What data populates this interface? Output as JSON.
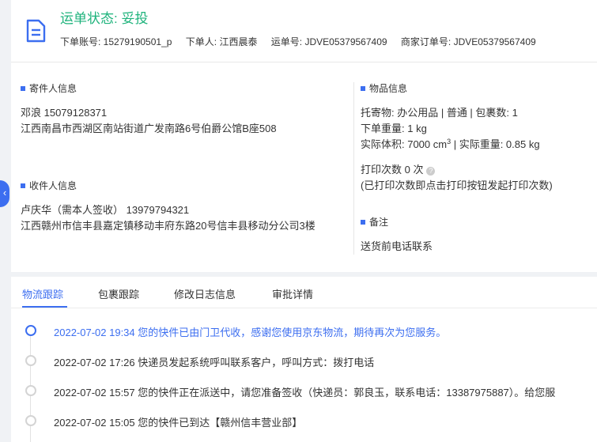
{
  "header": {
    "status": "运单状态: 妥投",
    "order_account": "下单账号: 15279190501_p",
    "orderer": "下单人: 江西晨泰",
    "waybill": "运单号: JDVE05379567409",
    "merchant_order": "商家订单号: JDVE05379567409"
  },
  "sender": {
    "title": "寄件人信息",
    "name_phone": "邓浪    15079128371",
    "address": "江西南昌市西湖区南站街道广发南路6号伯爵公馆B座508"
  },
  "receiver": {
    "title": "收件人信息",
    "name_phone": "卢庆华（需本人签收）   13979794321",
    "address": "江西赣州市信丰县嘉定镇移动丰府东路20号信丰县移动分公司3楼"
  },
  "goods": {
    "title": "物品信息",
    "line1": "托寄物:  办公用品 | 普通  |  包裹数:  1",
    "line2": "下单重量:  1 kg",
    "volume_prefix": "实际体积:   7000 cm",
    "volume_sup": "3",
    "volume_suffix": " |  实际重量:   0.85 kg",
    "print_count": "打印次数    0 次",
    "help_glyph": "?",
    "print_note": "(已打印次数即点击打印按钮发起打印次数)"
  },
  "remark": {
    "title": "备注",
    "text": "送货前电话联系"
  },
  "side_tab": {
    "glyph": "‹"
  },
  "tabs": [
    "物流跟踪",
    "包裹跟踪",
    "修改日志信息",
    "审批详情"
  ],
  "tracking": [
    {
      "text": "2022-07-02 19:34 您的快件已由门卫代收，感谢您使用京东物流，期待再次为您服务。",
      "current": true
    },
    {
      "text": "2022-07-02 17:26 快递员发起系统呼叫联系客户，呼叫方式：拨打电话",
      "current": false
    },
    {
      "text": "2022-07-02 15:57 您的快件正在派送中，请您准备签收（快递员：郭良玉，联系电话：13387975887）。给您服",
      "current": false
    },
    {
      "text": "2022-07-02 15:05 您的快件已到达【赣州信丰营业部】",
      "current": false
    }
  ],
  "colors": {
    "accent": "#3c6ef0",
    "status_green": "#1fb37c"
  }
}
